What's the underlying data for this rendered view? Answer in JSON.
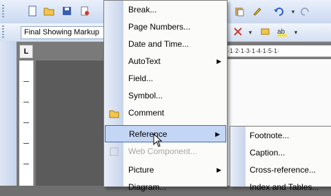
{
  "toolbar": {
    "display_for_review": "Final Showing Markup",
    "tab_stop": "L",
    "ruler_text": "·1·2·1·3·1·4·1·5·1·",
    "icons": [
      "new-icon",
      "open-icon",
      "save-icon",
      "permission-icon",
      "paste-icon",
      "format-painter-icon",
      "undo-icon",
      "redo-icon"
    ]
  },
  "menu": {
    "items": [
      {
        "label": "Break...",
        "disabled": false,
        "submenu": false
      },
      {
        "label": "Page Numbers...",
        "disabled": false,
        "submenu": false
      },
      {
        "label": "Date and Time...",
        "disabled": false,
        "submenu": false
      },
      {
        "label": "AutoText",
        "disabled": false,
        "submenu": true
      },
      {
        "label": "Field...",
        "disabled": false,
        "submenu": false
      },
      {
        "label": "Symbol...",
        "disabled": false,
        "submenu": false
      },
      {
        "label": "Comment",
        "disabled": false,
        "submenu": false,
        "icon": "comment-icon"
      },
      {
        "label": "Reference",
        "disabled": false,
        "submenu": true,
        "highlighted": true
      },
      {
        "label": "Web Component...",
        "disabled": true,
        "submenu": false
      },
      {
        "label": "Picture",
        "disabled": false,
        "submenu": true
      },
      {
        "label": "Diagram...",
        "disabled": false,
        "submenu": false
      }
    ]
  },
  "submenu": {
    "items": [
      {
        "label": "Footnote..."
      },
      {
        "label": "Caption..."
      },
      {
        "label": "Cross-reference..."
      },
      {
        "label": "Index and Tables..."
      }
    ]
  },
  "colors": {
    "highlight_bg": "#c4d6f5",
    "highlight_border": "#3f66b3",
    "disabled_text": "#a6a6a6"
  }
}
